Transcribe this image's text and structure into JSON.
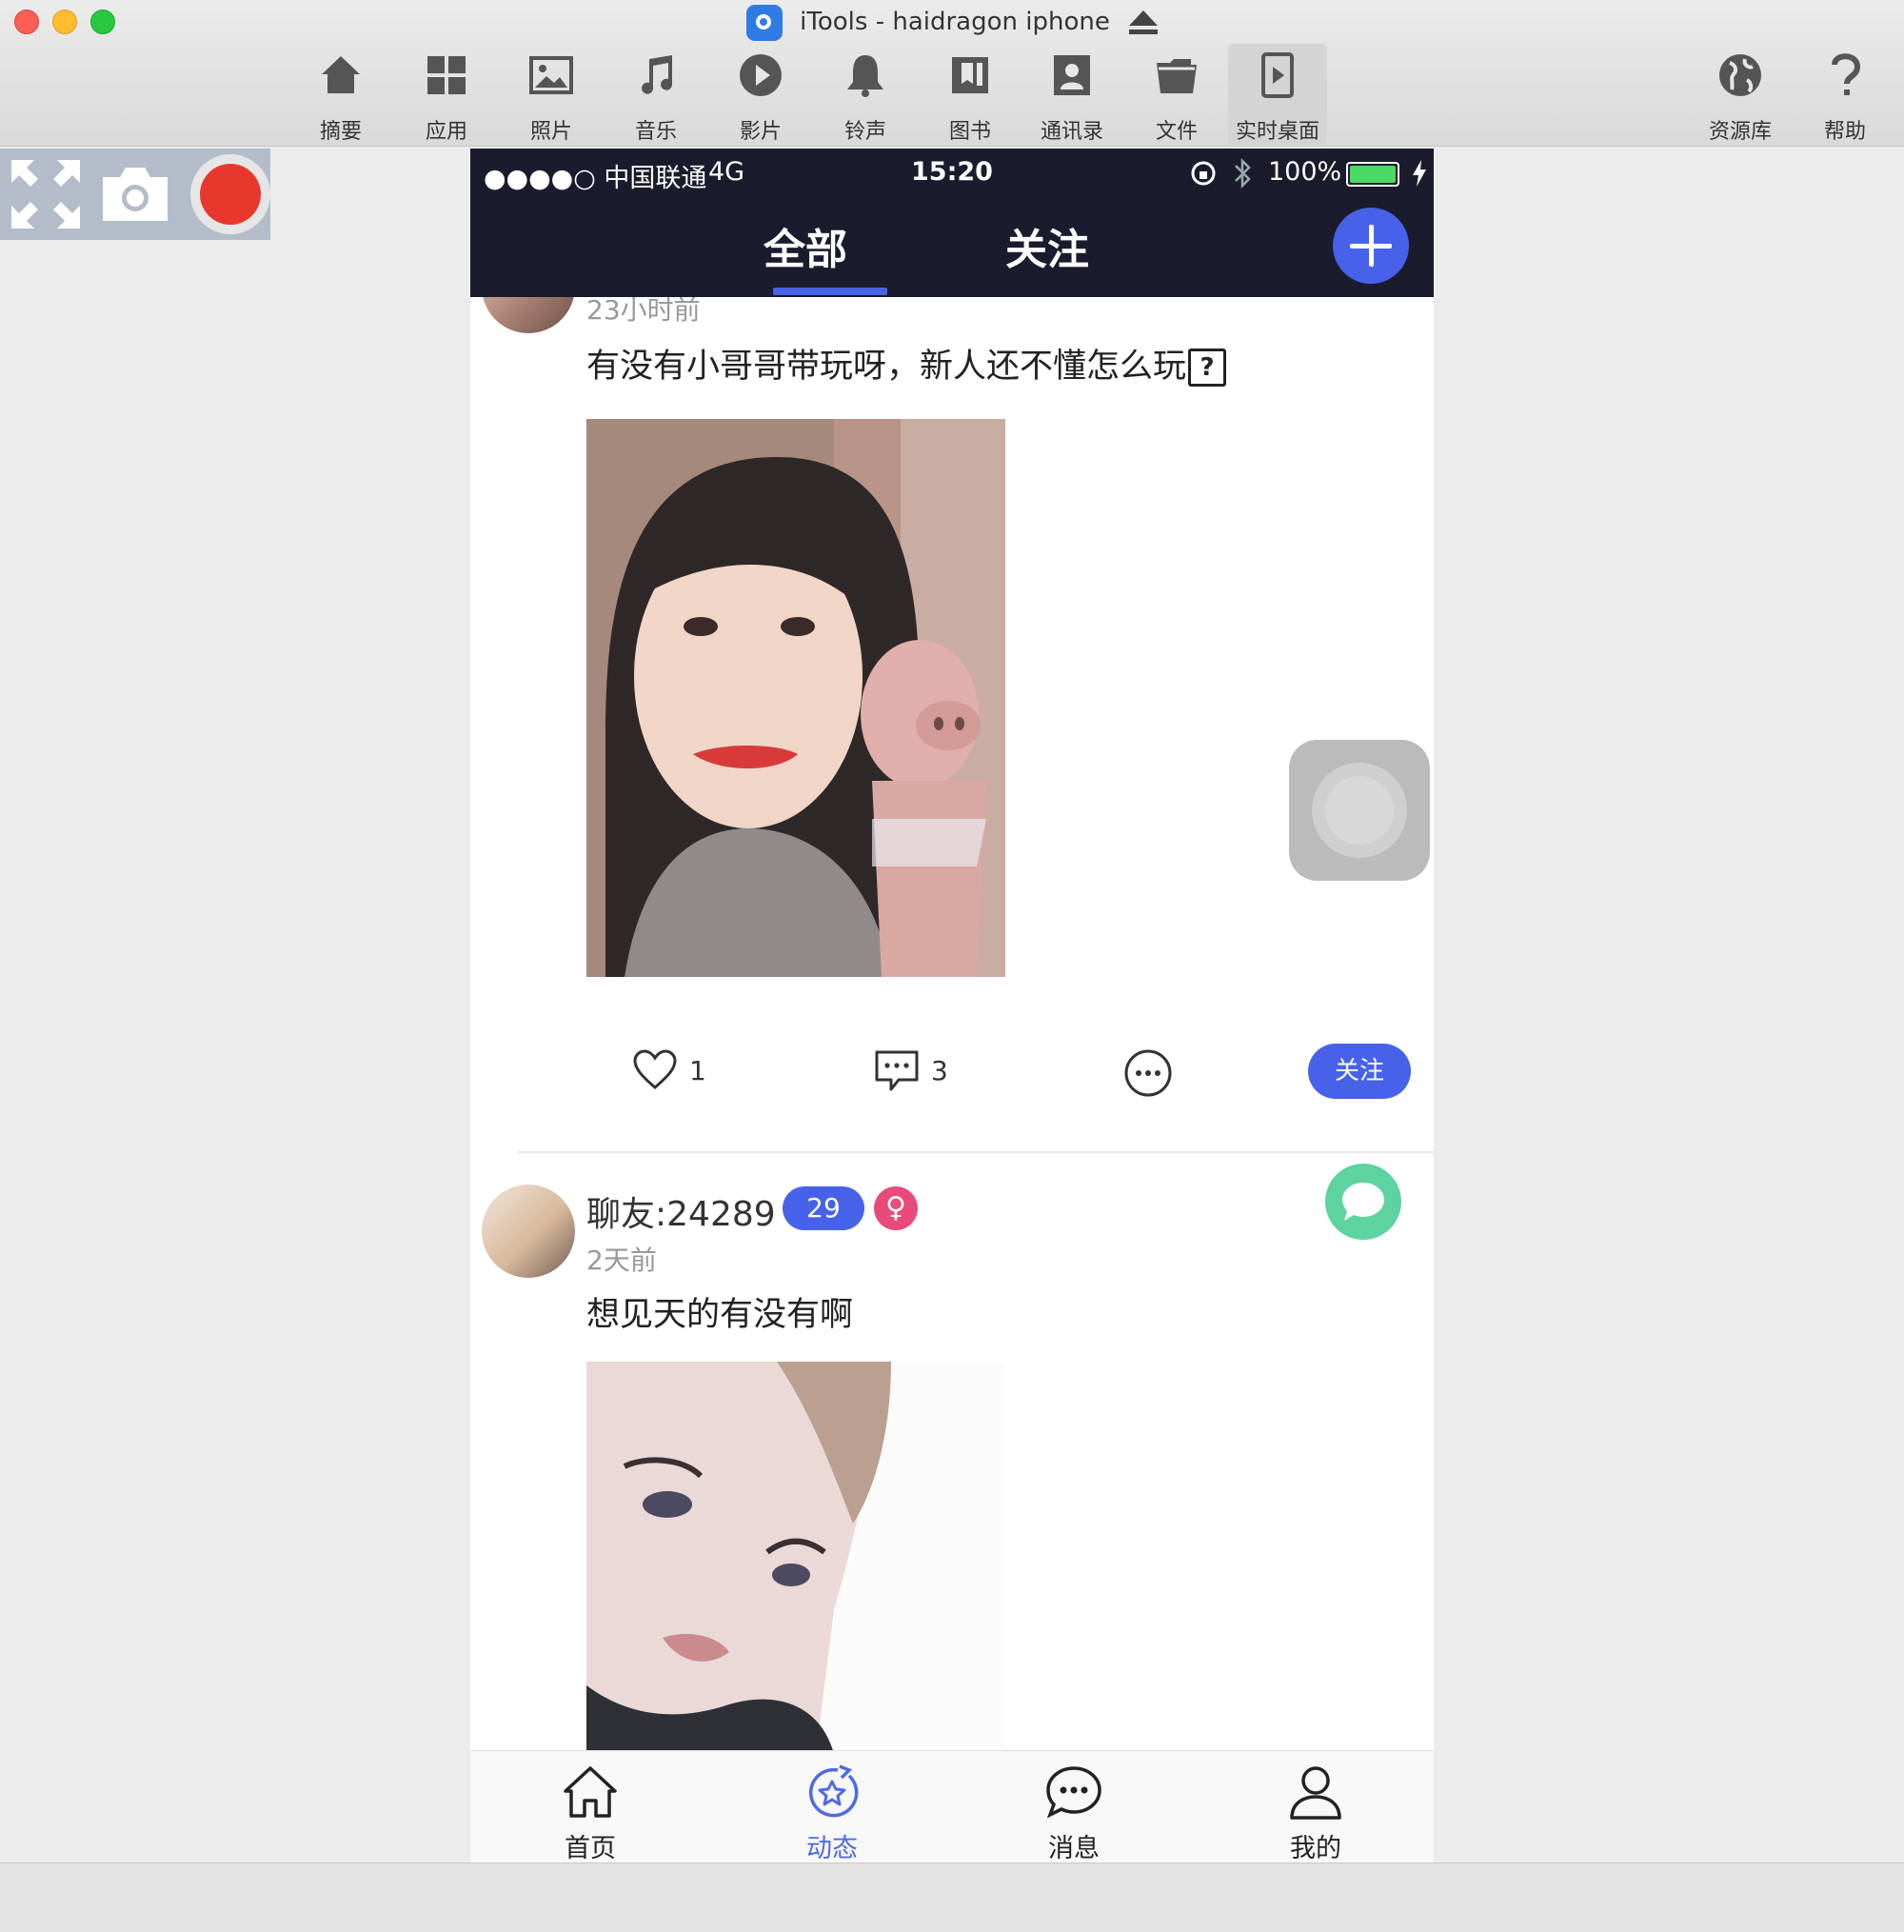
{
  "window": {
    "title": "iTools - haidragon iphone"
  },
  "toolbar": {
    "items": [
      {
        "label": "摘要",
        "icon": "home-icon"
      },
      {
        "label": "应用",
        "icon": "apps-icon"
      },
      {
        "label": "照片",
        "icon": "photo-icon"
      },
      {
        "label": "音乐",
        "icon": "music-icon"
      },
      {
        "label": "影片",
        "icon": "play-icon"
      },
      {
        "label": "铃声",
        "icon": "bell-icon"
      },
      {
        "label": "图书",
        "icon": "book-icon"
      },
      {
        "label": "通讯录",
        "icon": "contacts-icon"
      },
      {
        "label": "文件",
        "icon": "folder-icon"
      },
      {
        "label": "实时桌面",
        "icon": "live-desktop-icon"
      }
    ],
    "active_index": 9,
    "right_items": [
      {
        "label": "资源库",
        "icon": "globe-icon"
      },
      {
        "label": "帮助",
        "icon": "help-icon"
      }
    ]
  },
  "controls": {
    "fullscreen": "fullscreen-icon",
    "screenshot": "camera-icon",
    "record": "record-icon",
    "record_color": "#e8382d"
  },
  "status": {
    "carrier": "●●●●○ 中国联通",
    "network": "4G",
    "time": "15:20",
    "battery": "100%"
  },
  "nav": {
    "tab_all": "全部",
    "tab_follow": "关注",
    "accent": "#4762e9",
    "bg": "#1a1c2d"
  },
  "posts": [
    {
      "time": "23小时前",
      "text": "有没有小哥哥带玩呀，新人还不懂怎么玩",
      "emoji_box": "?",
      "likes": "1",
      "comments": "3",
      "follow_label": "关注"
    },
    {
      "username": "聊友:24289",
      "age": "29",
      "gender_symbol": "♀",
      "time": "2天前",
      "text": "想见天的有没有啊"
    }
  ],
  "bottom_tabs": [
    {
      "label": "首页",
      "icon": "home-outline-icon"
    },
    {
      "label": "动态",
      "icon": "moments-icon"
    },
    {
      "label": "消息",
      "icon": "message-icon"
    },
    {
      "label": "我的",
      "icon": "profile-icon"
    }
  ],
  "bottom_active_index": 1
}
